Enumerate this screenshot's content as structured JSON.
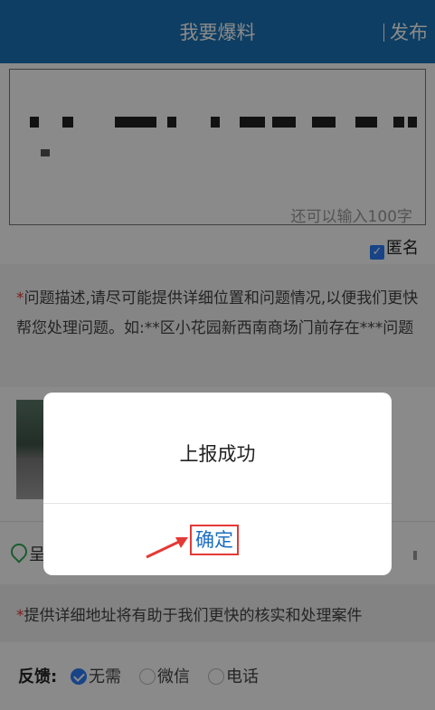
{
  "header": {
    "title": "我要爆料",
    "publish_label": "发布"
  },
  "report": {
    "counter_text": "还可以输入100字",
    "anonymous_label": "匿名",
    "anonymous_checked": true,
    "description_hint_marker": "*",
    "description_hint": "问题描述,请尽可能提供详细位置和问题情况,以便我们更快帮您处理问题。如:**区小花园新西南商场门前存在***问题"
  },
  "location": {
    "text": "呈"
  },
  "address_hint": {
    "marker": "*",
    "text": "提供详细地址将有助于我们更快的核实和处理案件"
  },
  "feedback": {
    "label": "反馈:",
    "options": [
      "无需",
      "微信",
      "电话"
    ],
    "selected": "无需"
  },
  "dialog": {
    "message": "上报成功",
    "confirm_label": "确定"
  },
  "colors": {
    "header": "#1b74b8",
    "accent": "#2d7ff9",
    "required": "#e53935",
    "highlight_box": "#e53935"
  },
  "icons": {
    "location": "location-pin-icon",
    "checkbox": "checkbox-checked-icon",
    "annotation": "arrow-icon"
  }
}
